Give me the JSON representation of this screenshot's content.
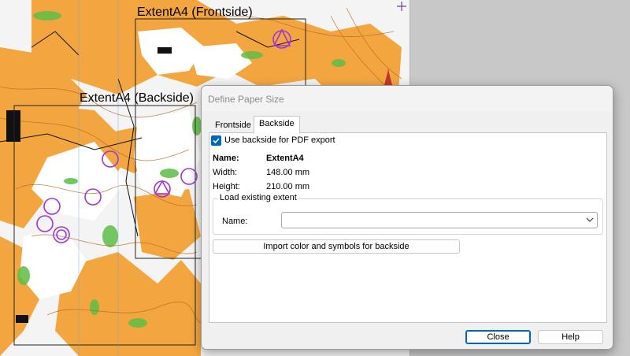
{
  "map": {
    "frontside_extent_label": "ExtentA4 (Frontside)",
    "backside_extent_label": "ExtentA4 (Backside)",
    "colors": {
      "orange": "#f3a640",
      "white": "#ffffff",
      "green": "#5dbd45",
      "purple": "#a035d6",
      "contour": "#b46a22",
      "grey_bg": "#cfcfcf"
    },
    "icons": [
      "plus-icon",
      "control-triangle-icon",
      "control-circle-icon",
      "north-arrow-icon"
    ]
  },
  "dialog": {
    "title": "Define Paper Size",
    "tabs": [
      {
        "label": "Frontside",
        "active": false
      },
      {
        "label": "Backside",
        "active": true
      }
    ],
    "use_backside": {
      "label": "Use backside for PDF export",
      "checked": true
    },
    "fields": {
      "name_label": "Name:",
      "name_value": "ExtentA4",
      "width_label": "Width:",
      "width_value": "148.00 mm",
      "height_label": "Height:",
      "height_value": "210.00 mm"
    },
    "load_extent": {
      "group_label": "Load existing extent",
      "name_label": "Name:",
      "name_value": ""
    },
    "import_button": "Import color and symbols for backside",
    "close_button": "Close",
    "help_button": "Help"
  }
}
